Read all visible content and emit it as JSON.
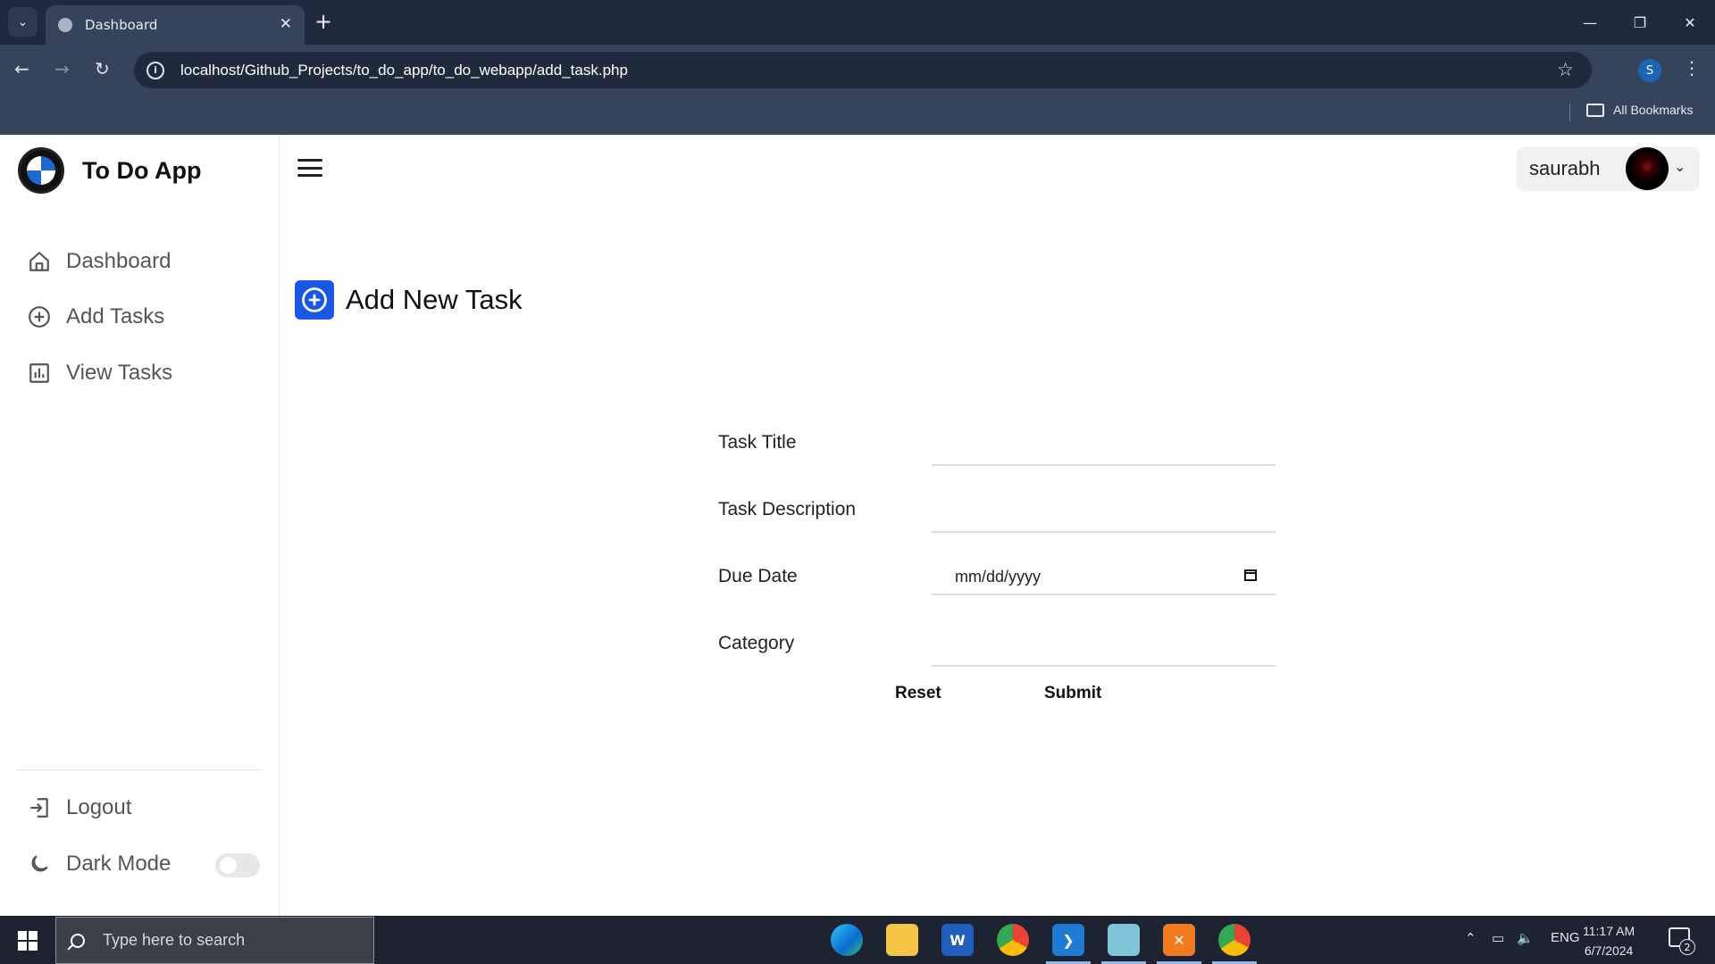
{
  "browser": {
    "tab_title": "Dashboard",
    "url": "localhost/Github_Projects/to_do_app/to_do_webapp/add_task.php",
    "profile_initial": "S",
    "bookmarks_label": "All Bookmarks"
  },
  "app": {
    "brand": "To Do App",
    "user_name": "saurabh"
  },
  "sidebar": {
    "items": [
      {
        "label": "Dashboard",
        "icon": "home-icon"
      },
      {
        "label": "Add Tasks",
        "icon": "plus-circle-icon"
      },
      {
        "label": "View Tasks",
        "icon": "bar-chart-icon"
      }
    ],
    "logout_label": "Logout",
    "dark_mode_label": "Dark Mode",
    "dark_mode_on": false
  },
  "page": {
    "title": "Add New Task"
  },
  "form": {
    "title_label": "Task Title",
    "description_label": "Task Description",
    "due_date_label": "Due Date",
    "due_date_placeholder": "mm/dd/yyyy",
    "category_label": "Category",
    "reset_label": "Reset",
    "submit_label": "Submit"
  },
  "taskbar": {
    "search_placeholder": "Type here to search",
    "language": "ENG",
    "time": "11:17 AM",
    "date": "6/7/2024",
    "notification_count": "2",
    "apps": [
      "edge",
      "file-explorer",
      "word",
      "chrome",
      "vscode",
      "notepad",
      "xampp",
      "chrome-profile"
    ]
  },
  "colors": {
    "accent": "#1a56e8",
    "chrome_dark": "#1f2a3c",
    "chrome_mid": "#35445a"
  }
}
